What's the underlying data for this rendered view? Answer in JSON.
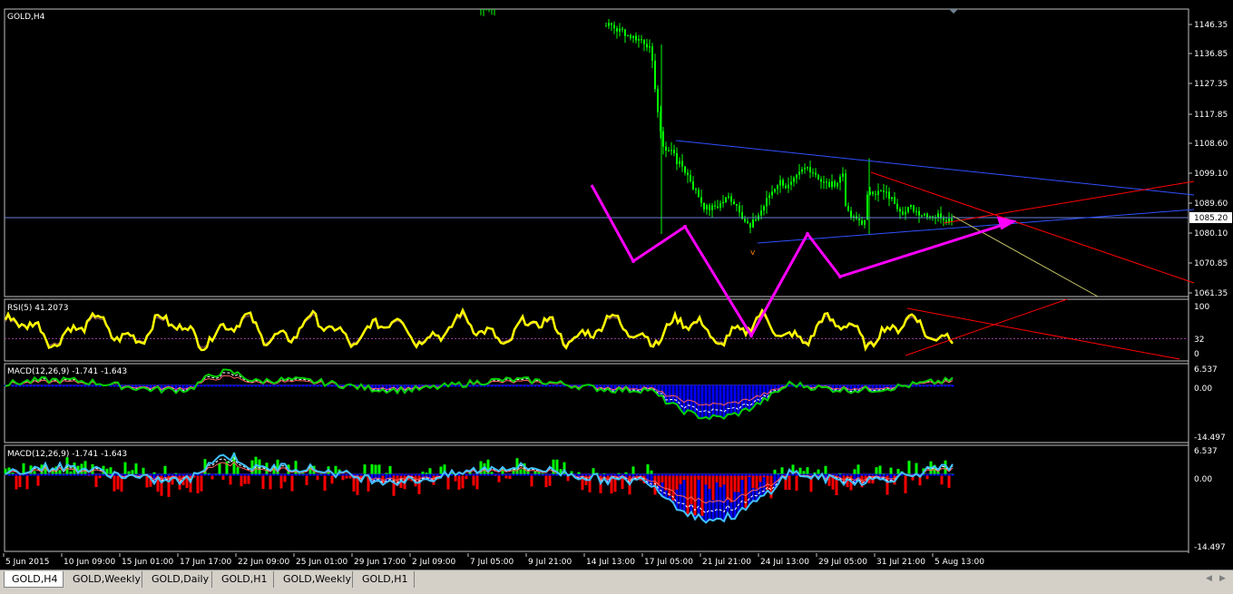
{
  "colors": {
    "background": "#000000",
    "grid": "#1a1a1a",
    "candle": "#00ff00",
    "bid_line": "#6b7fd6",
    "rsi": "#ffff00",
    "macd": "#00d000",
    "signal": "#ffffff",
    "hist_up": "#00ff00",
    "hist_down": "#ff0000",
    "hist_blue": "#0000ff",
    "trend_blue": "#3050ff",
    "trend_red": "#ff0000",
    "arrow": "#ff00ff",
    "axis_text": "#ffffff"
  },
  "main": {
    "title": "GOLD,H4",
    "price_ticks": [
      "1146.35",
      "1136.85",
      "1127.35",
      "1117.85",
      "1108.60",
      "1099.10",
      "1089.60",
      "1080.10",
      "1070.85",
      "1061.35"
    ],
    "price_min": 1061.35,
    "price_max": 1146.35,
    "current_price_label": "1085.20",
    "current_price": 1085.2
  },
  "rsi": {
    "title": "RSI(5) 41.2073",
    "ticks": [
      "100",
      "32",
      "0"
    ]
  },
  "macd1": {
    "title": "MACD(12,26,9) -1.741 -1.643",
    "ticks": [
      "6.537",
      "0.00",
      "-14.497"
    ]
  },
  "macd2": {
    "title": "MACD(12,26,9) -1.741 -1.643",
    "ticks": [
      "6.537",
      "0.00",
      "-14.497"
    ]
  },
  "time_labels": [
    "5 Jun 2015",
    "10 Jun 09:00",
    "15 Jun 01:00",
    "17 Jun 17:00",
    "22 Jun 09:00",
    "25 Jun 01:00",
    "29 Jun 17:00",
    "2 Jul 09:00",
    "7 Jul 05:00",
    "9 Jul 21:00",
    "14 Jul 13:00",
    "17 Jul 05:00",
    "21 Jul 21:00",
    "24 Jul 13:00",
    "29 Jul 05:00",
    "31 Jul 21:00",
    "5 Aug 13:00"
  ],
  "tabs": [
    {
      "label": "GOLD,H4",
      "active": true
    },
    {
      "label": "GOLD,Weekly",
      "active": false
    },
    {
      "label": "GOLD,Daily",
      "active": false
    },
    {
      "label": "GOLD,H1",
      "active": false
    },
    {
      "label": "GOLD,Weekly",
      "active": false
    },
    {
      "label": "GOLD,H1",
      "active": false
    }
  ],
  "scroll_left_icon": "triangle-left-icon",
  "scroll_right_icon": "triangle-right-icon"
}
